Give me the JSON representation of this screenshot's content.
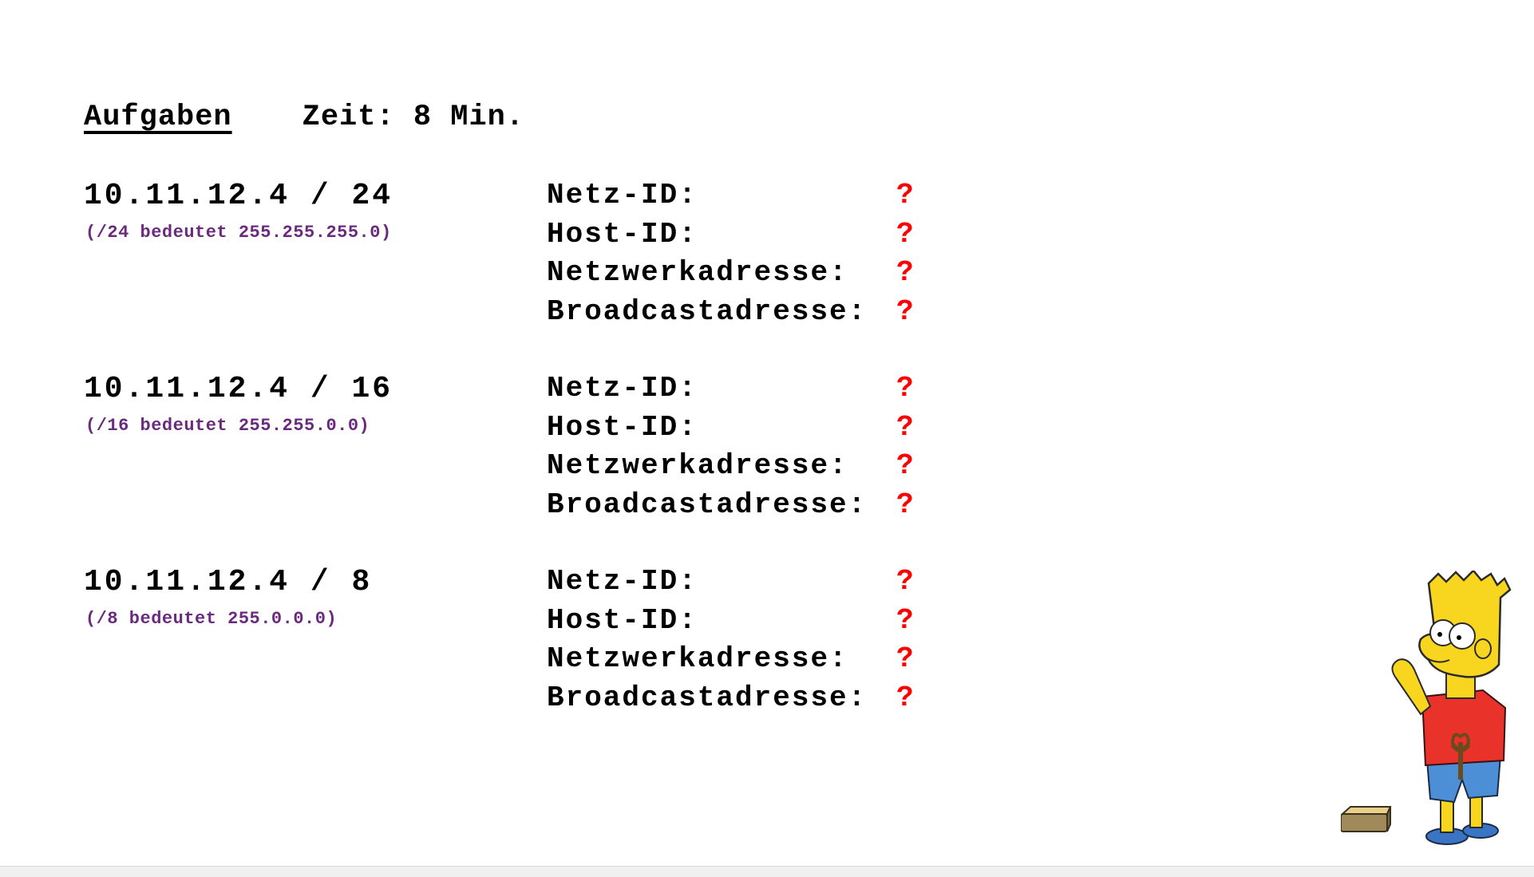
{
  "header": {
    "title": "Aufgaben",
    "time": "Zeit: 8 Min."
  },
  "tasks": [
    {
      "ip": "10.11.12.4 / 24",
      "hint": "(/24 bedeutet 255.255.255.0)",
      "fields": [
        {
          "label": "Netz-ID:",
          "answer": "?"
        },
        {
          "label": "Host-ID:",
          "answer": "?"
        },
        {
          "label": "Netzwerkadresse:",
          "answer": "?"
        },
        {
          "label": "Broadcastadresse:",
          "answer": "?"
        }
      ]
    },
    {
      "ip": "10.11.12.4 / 16",
      "hint": "(/16 bedeutet 255.255.0.0)",
      "fields": [
        {
          "label": "Netz-ID:",
          "answer": "?"
        },
        {
          "label": "Host-ID:",
          "answer": "?"
        },
        {
          "label": "Netzwerkadresse:",
          "answer": "?"
        },
        {
          "label": "Broadcastadresse:",
          "answer": "?"
        }
      ]
    },
    {
      "ip": "10.11.12.4 / 8",
      "hint": "(/8 bedeutet 255.0.0.0)",
      "fields": [
        {
          "label": "Netz-ID:",
          "answer": "?"
        },
        {
          "label": "Host-ID:",
          "answer": "?"
        },
        {
          "label": "Netzwerkadresse:",
          "answer": "?"
        },
        {
          "label": "Broadcastadresse:",
          "answer": "?"
        }
      ]
    }
  ],
  "colors": {
    "answer": "#ff0000",
    "hint": "#6a2a7e"
  },
  "illustration": "bart-simpson-slingshot-cartoon"
}
